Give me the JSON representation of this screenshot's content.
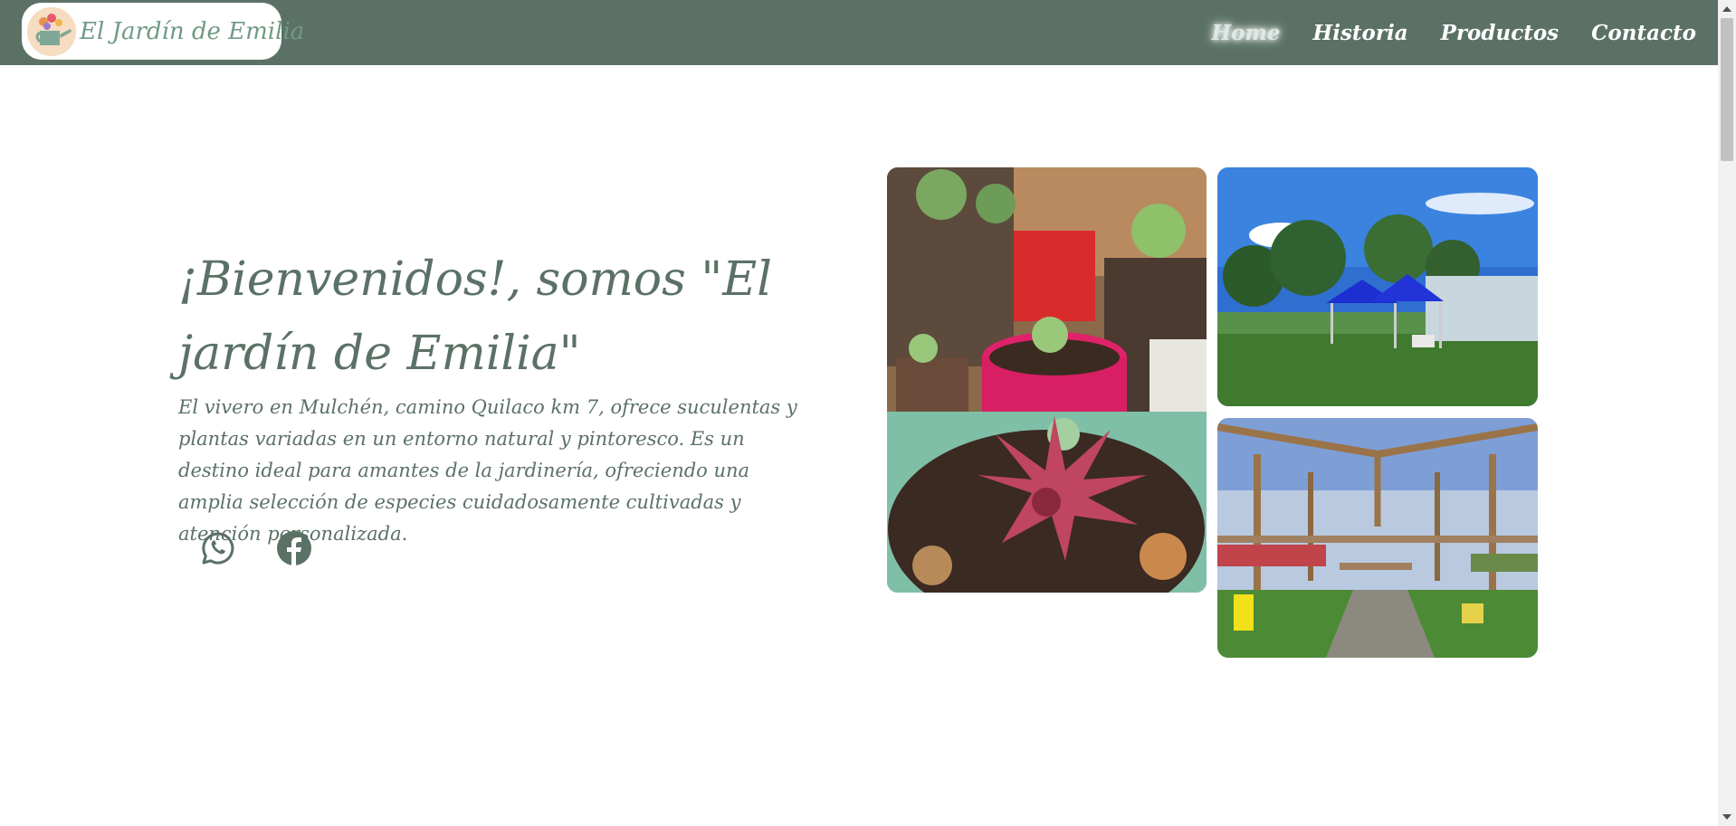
{
  "brand": {
    "name": "El Jardín de Emilia",
    "logo_icon": "watering-can-flowers-icon"
  },
  "nav": {
    "items": [
      {
        "label": "Home",
        "active": true
      },
      {
        "label": "Historia",
        "active": false
      },
      {
        "label": "Productos",
        "active": false
      },
      {
        "label": "Contacto",
        "active": false
      }
    ]
  },
  "hero": {
    "title": "¡Bienvenidos!, somos \"El jardín de Emilia\"",
    "description": "El vivero en Mulchén, camino Quilaco km 7, ofrece suculentas y plantas variadas en un entorno natural y pintoresco. Es un destino ideal para amantes de la jardinería, ofreciendo una amplia selección de especies cuidadosamente cultivadas y atención personalizada."
  },
  "social": [
    {
      "icon": "whatsapp-icon"
    },
    {
      "icon": "facebook-icon"
    }
  ],
  "gallery": [
    {
      "content": "succulents-in-pots-photo"
    },
    {
      "content": "garden-tents-and-greenhouse-photo"
    },
    {
      "content": "greenhouse-interior-photo"
    }
  ],
  "colors": {
    "primary": "#5b7166",
    "logo_text": "#6f9a85",
    "background": "#ffffff"
  }
}
